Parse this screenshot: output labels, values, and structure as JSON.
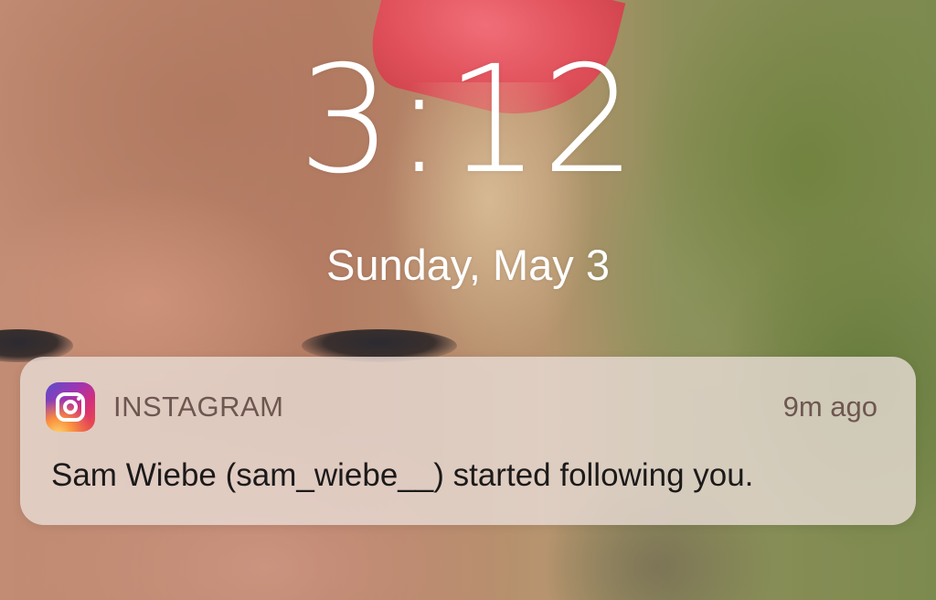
{
  "lock_screen": {
    "time": "3:12",
    "date": "Sunday, May 3"
  },
  "notification": {
    "app_icon": "instagram-icon",
    "app_name": "INSTAGRAM",
    "time_ago": "9m ago",
    "message": "Sam Wiebe (sam_wiebe__) started following you."
  }
}
